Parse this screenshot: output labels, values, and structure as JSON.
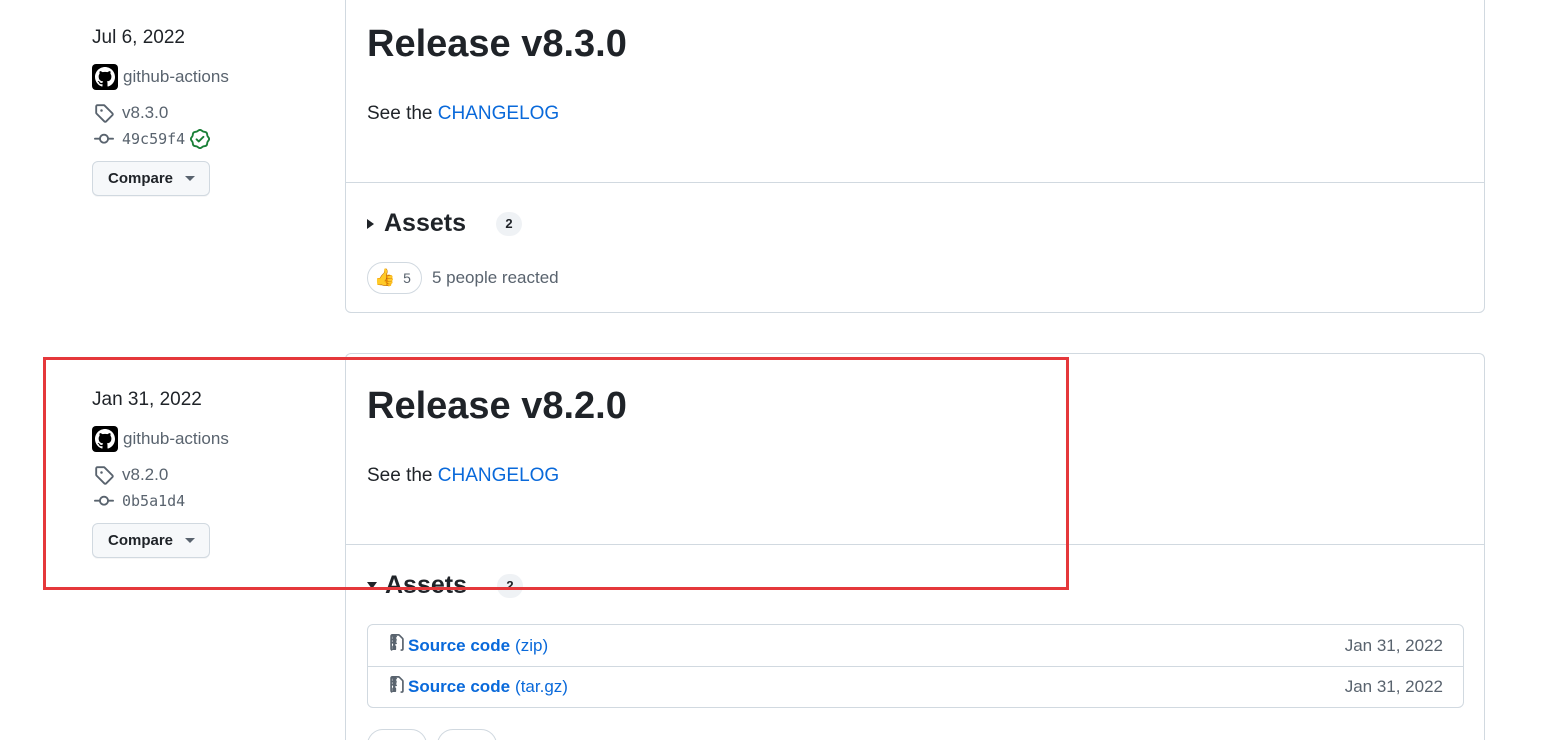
{
  "releases": [
    {
      "date": "Jul 6, 2022",
      "author": "github-actions",
      "tag": "v8.3.0",
      "commit": "49c59f4",
      "commit_verified": true,
      "compare_label": "Compare",
      "title": "Release v8.3.0",
      "body_prefix": "See the ",
      "body_link": "CHANGELOG",
      "assets_label": "Assets",
      "assets_count": "2",
      "assets_expanded": false,
      "reaction_emoji": "👍",
      "reaction_count": "5",
      "reaction_text": "5 people reacted"
    },
    {
      "date": "Jan 31, 2022",
      "author": "github-actions",
      "tag": "v8.2.0",
      "commit": "0b5a1d4",
      "commit_verified": false,
      "compare_label": "Compare",
      "title": "Release v8.2.0",
      "body_prefix": "See the ",
      "body_link": "CHANGELOG",
      "assets_label": "Assets",
      "assets_count": "2",
      "assets_expanded": true,
      "assets": [
        {
          "name": "Source code",
          "ext": "(zip)",
          "date": "Jan 31, 2022"
        },
        {
          "name": "Source code",
          "ext": "(tar.gz)",
          "date": "Jan 31, 2022"
        }
      ]
    }
  ],
  "colors": {
    "link": "#0969da",
    "border": "#d1d9e0",
    "highlight": "#e5383b",
    "verified": "#1a7f37"
  },
  "icons": {
    "avatar": "github-mark-icon",
    "tag": "tag-icon",
    "commit": "git-commit-icon",
    "verified": "verified-check-icon",
    "archive": "file-zip-icon",
    "expand": "triangle-right-icon",
    "collapse": "triangle-down-icon"
  }
}
